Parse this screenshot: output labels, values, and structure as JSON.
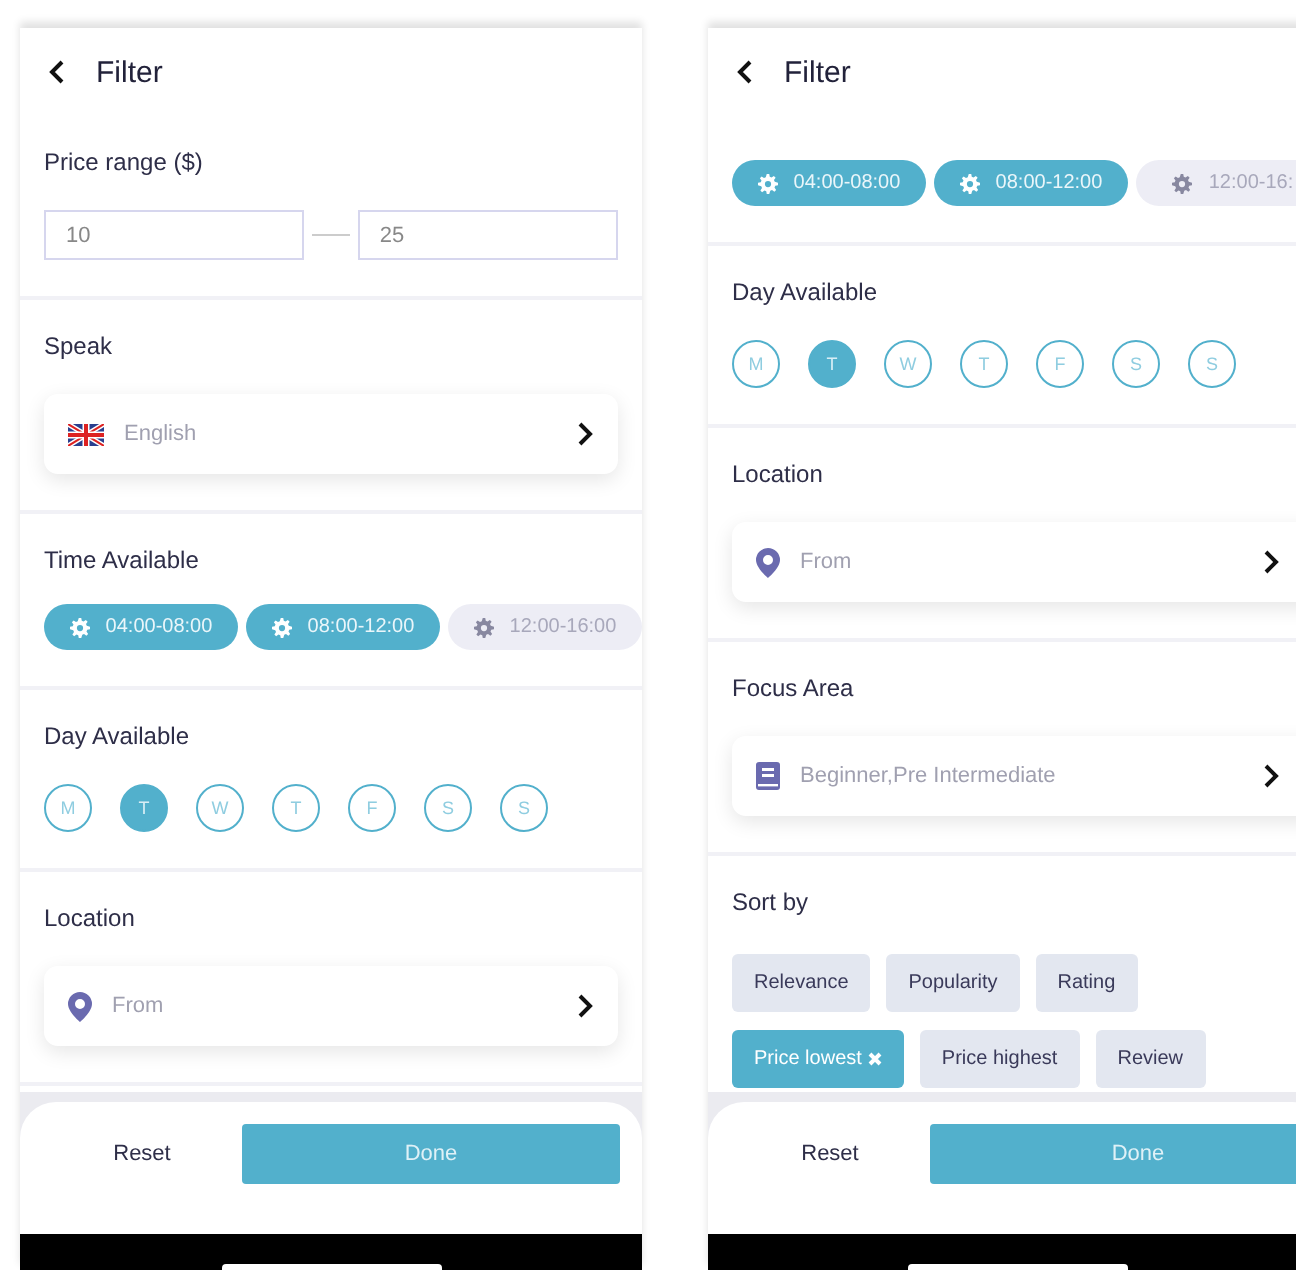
{
  "screens": [
    {
      "title": "Filter",
      "sections": [
        {
          "kind": "range",
          "label": "Price range ($)",
          "min": "10",
          "max": "25"
        },
        {
          "kind": "language",
          "label": "Speak",
          "value": "English"
        },
        {
          "kind": "times",
          "label": "Time Available",
          "items": [
            {
              "label": "04:00-08:00",
              "selected": true
            },
            {
              "label": "08:00-12:00",
              "selected": true
            },
            {
              "label": "12:00-16:00",
              "selected": false
            }
          ]
        },
        {
          "kind": "days",
          "label": "Day Available",
          "items": [
            {
              "label": "M",
              "selected": false
            },
            {
              "label": "T",
              "selected": true
            },
            {
              "label": "W",
              "selected": false
            },
            {
              "label": "T",
              "selected": false
            },
            {
              "label": "F",
              "selected": false
            },
            {
              "label": "S",
              "selected": false
            },
            {
              "label": "S",
              "selected": false
            }
          ]
        },
        {
          "kind": "location",
          "label": "Location",
          "value": "From"
        }
      ],
      "footer": {
        "reset": "Reset",
        "done": "Done"
      }
    },
    {
      "title": "Filter",
      "sections": [
        {
          "kind": "times",
          "items": [
            {
              "label": "04:00-08:00",
              "selected": true
            },
            {
              "label": "08:00-12:00",
              "selected": true
            },
            {
              "label": "12:00-16:",
              "selected": false
            }
          ]
        },
        {
          "kind": "days",
          "label": "Day Available",
          "items": [
            {
              "label": "M",
              "selected": false
            },
            {
              "label": "T",
              "selected": true
            },
            {
              "label": "W",
              "selected": false
            },
            {
              "label": "T",
              "selected": false
            },
            {
              "label": "F",
              "selected": false
            },
            {
              "label": "S",
              "selected": false
            },
            {
              "label": "S",
              "selected": false
            }
          ]
        },
        {
          "kind": "location",
          "label": "Location",
          "value": "From"
        },
        {
          "kind": "focus",
          "label": "Focus Area",
          "value": "Beginner,Pre Intermediate"
        },
        {
          "kind": "sort",
          "label": "Sort by",
          "rows": [
            [
              {
                "label": "Relevance",
                "selected": false
              },
              {
                "label": "Popularity",
                "selected": false
              },
              {
                "label": "Rating",
                "selected": false
              }
            ],
            [
              {
                "label": "Price lowest",
                "selected": true
              },
              {
                "label": "Price highest",
                "selected": false
              },
              {
                "label": "Review",
                "selected": false
              }
            ]
          ]
        }
      ],
      "footer": {
        "reset": "Reset",
        "done": "Done"
      }
    }
  ]
}
